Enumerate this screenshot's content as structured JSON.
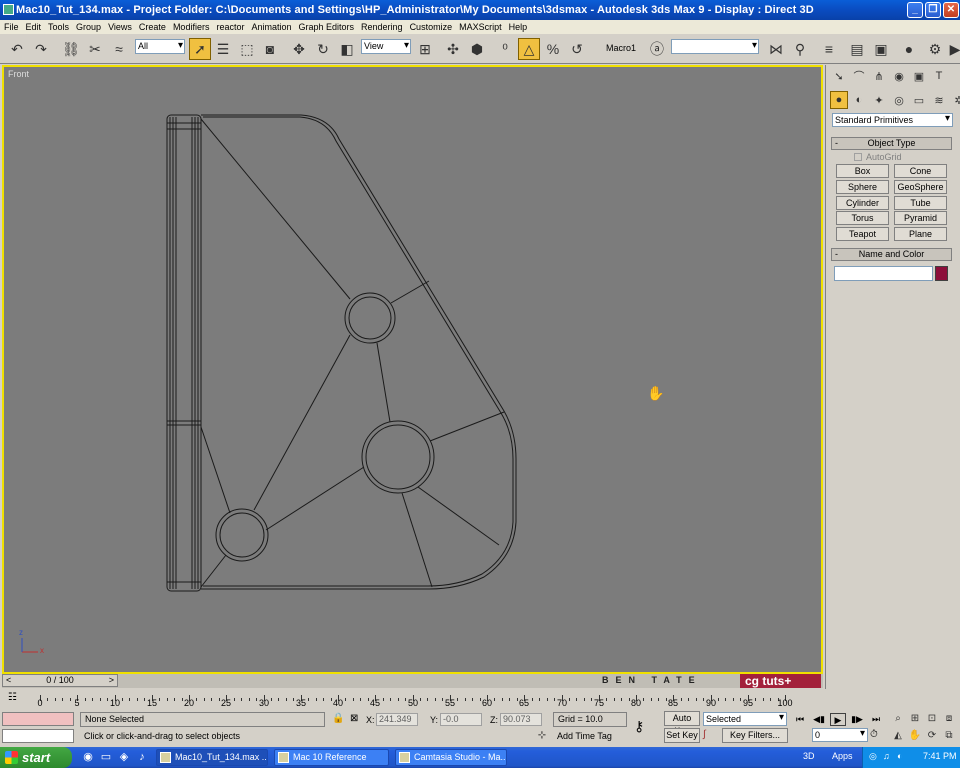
{
  "window": {
    "title": "Mac10_Tut_134.max    - Project Folder: C:\\Documents and Settings\\HP_Administrator\\My Documents\\3dsmax    - Autodesk 3ds Max 9    - Display : Direct 3D",
    "minimize_glyph": "_",
    "restore_glyph": "❐",
    "close_glyph": "✕"
  },
  "menu": [
    "File",
    "Edit",
    "Tools",
    "Group",
    "Views",
    "Create",
    "Modifiers",
    "reactor",
    "Animation",
    "Graph Editors",
    "Rendering",
    "Customize",
    "MAXScript",
    "Help"
  ],
  "toolbar": {
    "selection_filter": "All",
    "reference_coord": "View",
    "macro_label": "Macro1",
    "named_selection": ""
  },
  "viewport": {
    "label": "Front",
    "axis_x": "x",
    "axis_z": "z",
    "background": "#7c7c7c",
    "border": "#f0e000"
  },
  "command_panel": {
    "category": "Standard Primitives",
    "object_type_title": "Object Type",
    "autogrid_label": "AutoGrid",
    "primitives": [
      "Box",
      "Cone",
      "Sphere",
      "GeoSphere",
      "Cylinder",
      "Tube",
      "Torus",
      "Pyramid",
      "Teapot",
      "Plane"
    ],
    "name_color_title": "Name and Color",
    "name_value": "",
    "object_color": "#8c0e3a"
  },
  "timeslider": {
    "frame_display": "0 / 100",
    "prev_glyph": "<",
    "next_glyph": ">"
  },
  "branding": {
    "author": "BEN TATE",
    "logo": "cg tuts+"
  },
  "trackbar": {
    "ticks": [
      "0",
      "5",
      "10",
      "15",
      "20",
      "25",
      "30",
      "35",
      "40",
      "45",
      "50",
      "55",
      "60",
      "65",
      "70",
      "75",
      "80",
      "85",
      "90",
      "95",
      "100"
    ]
  },
  "status": {
    "selection": "None Selected",
    "prompt": "Click or click-and-drag to select objects",
    "x_label": "X:",
    "x_value": "241.349",
    "y_label": "Y:",
    "y_value": "-0.0",
    "z_label": "Z:",
    "z_value": "90.073",
    "grid": "Grid = 10.0",
    "add_time_tag": "Add Time Tag",
    "auto_key": "Auto Key",
    "set_key": "Set Key",
    "key_mode": "Selected",
    "key_filters": "Key Filters...",
    "current_frame": "0"
  },
  "taskbar": {
    "start_label": "start",
    "tasks": [
      "Mac10_Tut_134.max ...",
      "Mac 10 Reference",
      "Camtasia Studio - Ma..."
    ],
    "tray_3d": "3D",
    "tray_apps": "Apps",
    "clock": "7:41 PM"
  }
}
